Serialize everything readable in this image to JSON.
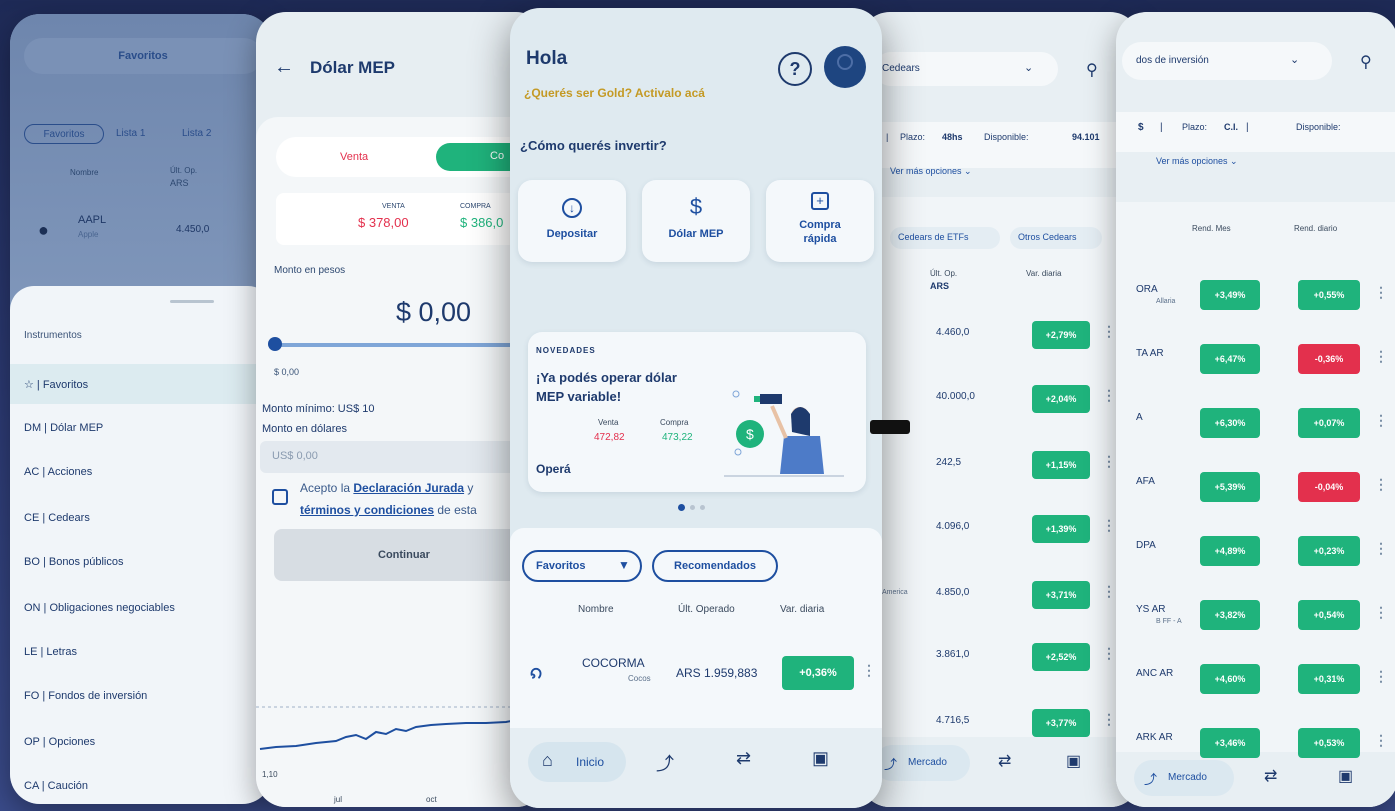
{
  "screen_favorites": {
    "tab_title": "Favoritos",
    "lists": [
      "Favoritos",
      "Lista 1",
      "Lista 2"
    ],
    "col_name": "Nombre",
    "col_last": "Últ. Op.",
    "col_last_ccy": "ARS",
    "row_ticker": "AAPL",
    "row_sub": "Apple",
    "row_value": "4.450,0",
    "sheet_title": "Instrumentos",
    "items": [
      {
        "label": "☆ | Favoritos"
      },
      {
        "label": "DM | Dólar MEP"
      },
      {
        "label": "AC | Acciones"
      },
      {
        "label": "CE | Cedears"
      },
      {
        "label": "BO | Bonos públicos"
      },
      {
        "label": "ON | Obligaciones negociables"
      },
      {
        "label": "LE | Letras"
      },
      {
        "label": "FO | Fondos de inversión"
      },
      {
        "label": "OP | Opciones"
      },
      {
        "label": "CA | Caución"
      }
    ]
  },
  "screen_mep": {
    "title": "Dólar MEP",
    "tab_sell": "Venta",
    "tab_buy": "Co",
    "sell_label": "VENTA",
    "sell_value": "$ 378,00",
    "buy_label": "COMPRA",
    "buy_value": "$ 386,0",
    "amount_label": "Monto en pesos",
    "amount": "$ 0,00",
    "slider_min": "$ 0,00",
    "min_amount": "Monto mínimo: US$ 10",
    "usd_label": "Monto en dólares",
    "usd_placeholder": "US$ 0,00",
    "terms_prefix": "Acepto la ",
    "terms_link1": "Declaración Jurada",
    "terms_mid": " y",
    "terms_link2": "términos y condiciones",
    "terms_suffix": " de esta",
    "continue": "Continuar",
    "chart_y": "1,10",
    "chart_x": [
      "jul",
      "oct",
      ""
    ]
  },
  "screen_home": {
    "greeting": "Hola",
    "gold": "¿Querés ser Gold? Activalo acá",
    "question": "¿Cómo querés invertir?",
    "actions": [
      {
        "label": "Depositar"
      },
      {
        "label": "Dólar MEP"
      },
      {
        "label": "Compra rápida"
      }
    ],
    "news_tag": "NOVEDADES",
    "news_title": "¡Ya podés operar dólar MEP variable!",
    "news_sell_label": "Venta",
    "news_buy_label": "Compra",
    "news_sell": "472,82",
    "news_buy": "473,22",
    "news_cta": "Operá",
    "filter_fav": "Favoritos",
    "filter_rec": "Recomendados",
    "col_name": "Nombre",
    "col_last": "Últ. Operado",
    "col_var": "Var. diaria",
    "row_ticker": "COCORMA",
    "row_sub": "Cocos",
    "row_price": "ARS 1.959,883",
    "row_var": "+0,36%",
    "nav_home": "Inicio"
  },
  "screen_cedears": {
    "selector": "Cedears",
    "plazo_label": "Plazo:",
    "plazo": "48hs",
    "disp_label": "Disponible:",
    "disp": "94.101",
    "more": "Ver más opciones",
    "tab1": "Cedears de ETFs",
    "tab2": "Otros Cedears",
    "col_last": "Últ. Op.",
    "col_last_ccy": "ARS",
    "col_var": "Var. diaria",
    "rows": [
      {
        "price": "4.460,0",
        "var": "+2,79%",
        "sub": ""
      },
      {
        "price": "40.000,0",
        "var": "+2,04%",
        "sub": ""
      },
      {
        "price": "242,5",
        "var": "+1,15%",
        "sub": ""
      },
      {
        "price": "4.096,0",
        "var": "+1,39%",
        "sub": ""
      },
      {
        "price": "4.850,0",
        "var": "+3,71%",
        "sub": "America"
      },
      {
        "price": "3.861,0",
        "var": "+2,52%",
        "sub": ""
      },
      {
        "price": "4.716,5",
        "var": "+3,77%",
        "sub": ""
      }
    ],
    "nav_market": "Mercado"
  },
  "screen_funds": {
    "selector": "dos de inversión",
    "ccy": "$",
    "plazo_label": "Plazo:",
    "plazo": "C.I.",
    "disp_label": "Disponible:",
    "more": "Ver más opciones",
    "col_month": "Rend. Mes",
    "col_day": "Rend. diario",
    "rows": [
      {
        "name": "ORA",
        "sub": "Allaria",
        "month": "+3,49%",
        "day": "+0,55%",
        "day_neg": false
      },
      {
        "name": "TA AR",
        "sub": "",
        "month": "+6,47%",
        "day": "-0,36%",
        "day_neg": true
      },
      {
        "name": "A",
        "sub": "",
        "month": "+6,30%",
        "day": "+0,07%",
        "day_neg": false
      },
      {
        "name": "AFA",
        "sub": "",
        "month": "+5,39%",
        "day": "-0,04%",
        "day_neg": true
      },
      {
        "name": "DPA",
        "sub": "",
        "month": "+4,89%",
        "day": "+0,23%",
        "day_neg": false
      },
      {
        "name": "YS AR",
        "sub": "B FF - A",
        "month": "+3,82%",
        "day": "+0,54%",
        "day_neg": false
      },
      {
        "name": "ANC AR",
        "sub": "",
        "month": "+4,60%",
        "day": "+0,31%",
        "day_neg": false
      },
      {
        "name": "ARK AR",
        "sub": "",
        "month": "+3,46%",
        "day": "+0,53%",
        "day_neg": false
      }
    ],
    "nav_market": "Mercado"
  },
  "colors": {
    "accent_green": "#1fb37c",
    "accent_red": "#e3304d",
    "navy": "#1e3a6d",
    "gold": "#c49a25"
  }
}
